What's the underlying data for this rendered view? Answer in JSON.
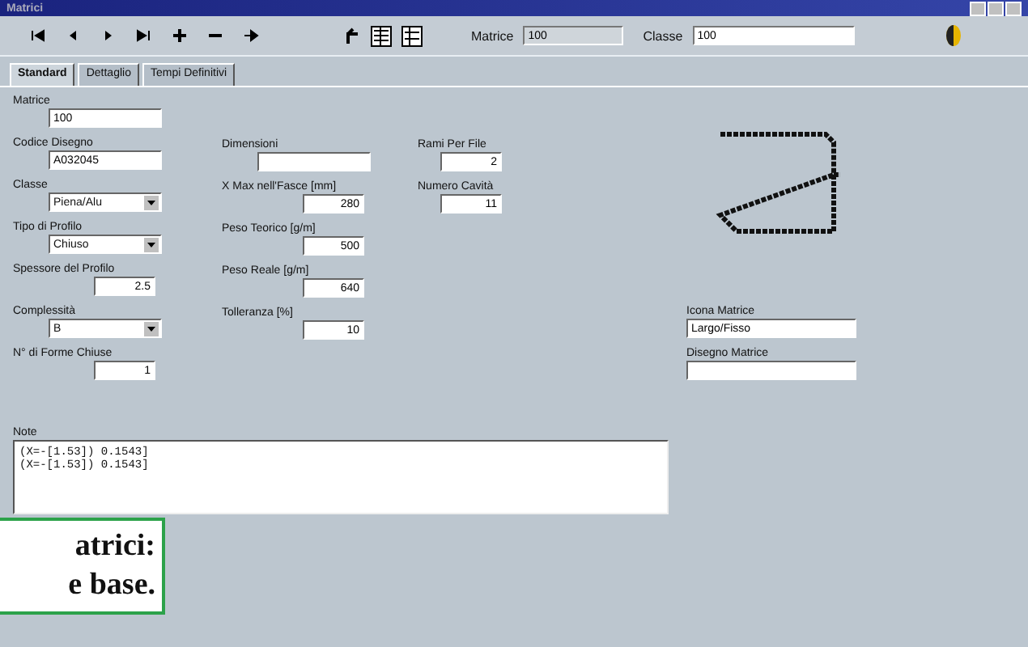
{
  "window": {
    "title": "Matrici"
  },
  "toolbar": {
    "fields": [
      {
        "label": "Matrice",
        "value": "100",
        "kind": "readonly"
      },
      {
        "label": "Classe",
        "value": "100",
        "kind": "text"
      }
    ]
  },
  "tabs": [
    {
      "label": "Standard",
      "selected": true
    },
    {
      "label": "Dettaglio",
      "selected": false
    },
    {
      "label": "Tempi Definitivi",
      "selected": false
    }
  ],
  "columns": [
    [
      {
        "label": "Matrice",
        "value": "100",
        "kind": "text"
      },
      {
        "label": "Codice Disegno",
        "value": "A032045",
        "kind": "text"
      },
      {
        "label": "Classe",
        "value": "Piena/Alu",
        "kind": "combo"
      },
      {
        "label": "Tipo di Profilo",
        "value": "Chiuso",
        "kind": "combo"
      },
      {
        "label": "Spessore del Profilo",
        "value": "2.5",
        "kind": "number"
      },
      {
        "label": "Complessità",
        "value": "B",
        "kind": "combo"
      },
      {
        "label": "N° di Forme Chiuse",
        "value": "1",
        "kind": "number"
      }
    ],
    [
      {
        "label": "Dimensioni",
        "kind": "text"
      },
      {
        "label": "X Max nell'Fasce [mm]",
        "value": "280",
        "kind": "number"
      },
      {
        "label": "Peso Teorico [g/m]",
        "value": "500",
        "kind": "number"
      },
      {
        "label": "Peso Reale [g/m]",
        "value": "640",
        "kind": "number"
      },
      {
        "label": "Tolleranza [%]",
        "value": "10",
        "kind": "number"
      }
    ],
    [
      {
        "label": "Rami Per File",
        "value": "2",
        "kind": "number"
      },
      {
        "label": "Numero Cavità",
        "value": "11",
        "kind": "number"
      }
    ]
  ],
  "side_fields": [
    {
      "label": "Icona Matrice",
      "value": "Largo/Fisso"
    },
    {
      "label": "Disegno Matrice"
    }
  ],
  "notes": {
    "label": "Note",
    "lines": [
      "(X=-[1.53]) 0.1543]",
      "(X=-[1.53]) 0.1543]"
    ]
  },
  "caption": [
    "atrici:",
    "e base."
  ]
}
